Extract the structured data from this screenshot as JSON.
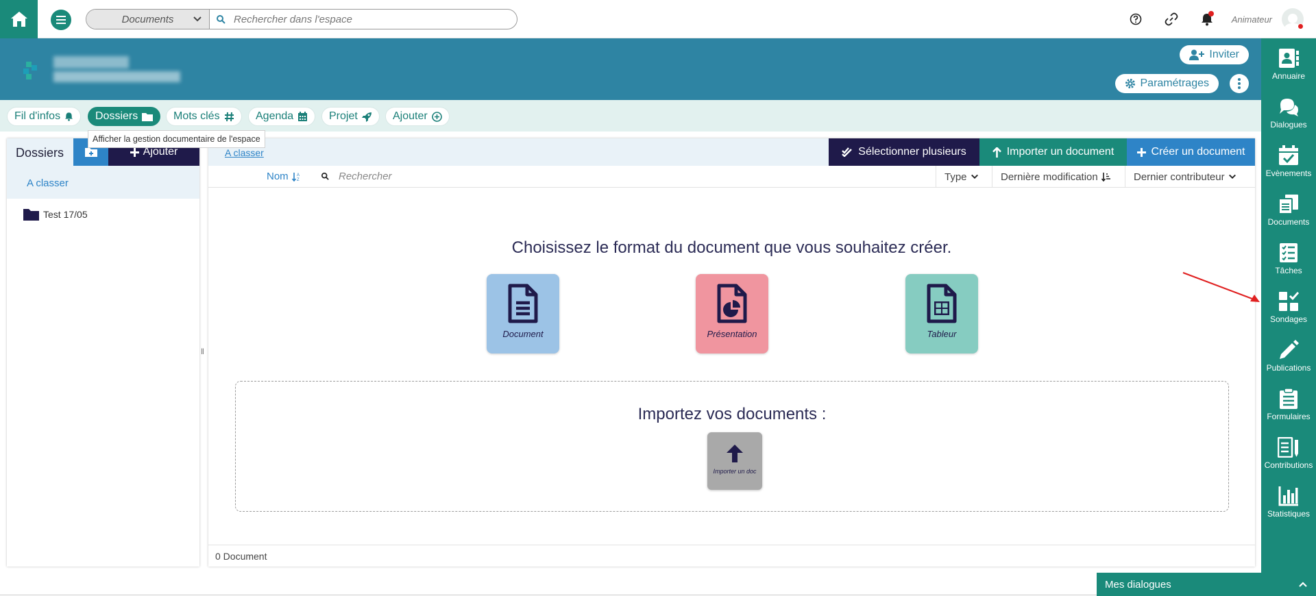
{
  "topbar": {
    "search_scope": "Documents",
    "search_placeholder": "Rechercher dans l'espace",
    "user_role": "Animateur"
  },
  "banner": {
    "invite_label": "Inviter",
    "settings_label": "Paramétrages"
  },
  "tabs": [
    {
      "label": "Fil d'infos",
      "icon": "bell-icon"
    },
    {
      "label": "Dossiers",
      "icon": "folder-icon",
      "active": true
    },
    {
      "label": "Mots clés",
      "icon": "hashtag-icon"
    },
    {
      "label": "Agenda",
      "icon": "calendar-icon"
    },
    {
      "label": "Projet",
      "icon": "rocket-icon"
    },
    {
      "label": "Ajouter",
      "icon": "plus-circle-icon"
    }
  ],
  "tooltip": "Afficher la gestion documentaire de l'espace",
  "folders_panel": {
    "title": "Dossiers",
    "add_label": "Ajouter",
    "active_item": "A classer",
    "folders": [
      "Test 17/05"
    ]
  },
  "main": {
    "breadcrumb": "A classer",
    "select_multiple_label": "Sélectionner plusieurs",
    "import_label": "Importer un document",
    "create_label": "Créer un document",
    "columns": {
      "name": "Nom",
      "search_placeholder": "Rechercher",
      "type": "Type",
      "last_modified": "Dernière modification",
      "last_contributor": "Dernier contributeur"
    },
    "create_title": "Choisissez le format du document que vous souhaitez créer.",
    "formats": [
      {
        "label": "Document",
        "color": "#9cc3e6"
      },
      {
        "label": "Présentation",
        "color": "#f0959f"
      },
      {
        "label": "Tableur",
        "color": "#86ccc1"
      }
    ],
    "import_title": "Importez vos documents :",
    "import_card_label": "Importer un doc",
    "footer_count": "0 Document"
  },
  "rightbar": {
    "items": [
      {
        "label": "Annuaire",
        "icon": "contacts-book-icon"
      },
      {
        "label": "Dialogues",
        "icon": "chat-bubbles-icon"
      },
      {
        "label": "Evènements",
        "icon": "calendar-check-icon"
      },
      {
        "label": "Documents",
        "icon": "copy-documents-icon"
      },
      {
        "label": "Tâches",
        "icon": "task-list-icon"
      },
      {
        "label": "Sondages",
        "icon": "poll-grid-icon"
      },
      {
        "label": "Publications",
        "icon": "pencil-icon"
      },
      {
        "label": "Formulaires",
        "icon": "clipboard-list-icon"
      },
      {
        "label": "Contributions",
        "icon": "contributions-icon"
      },
      {
        "label": "Statistiques",
        "icon": "bar-chart-icon"
      }
    ]
  },
  "dialogs_bar": {
    "label": "Mes dialogues"
  },
  "colors": {
    "teal": "#1a8a7a",
    "banner_blue": "#2e84a3",
    "navy": "#1f1a4a",
    "action_blue": "#2e84c7",
    "annotation_arrow": "#e02020"
  }
}
